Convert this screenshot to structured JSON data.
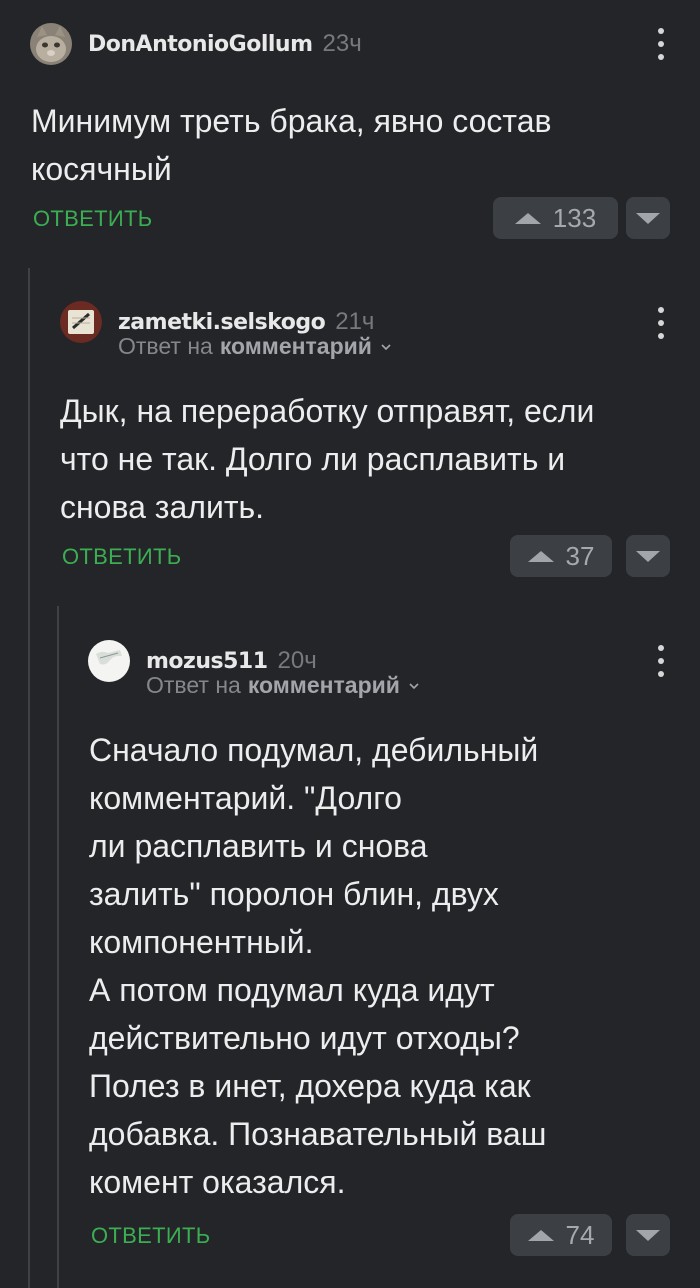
{
  "comments": [
    {
      "username": "DonAntonioGollum",
      "time": "23ч",
      "text": "Минимум треть брака, явно состав\nкосячный",
      "reply_label": "ОТВЕТИТЬ",
      "votes": "133",
      "avatar": "cat-avatar"
    },
    {
      "username": "zametki.selskogo",
      "time": "21ч",
      "reply_prefix": "Ответ на",
      "reply_target": "комментарий",
      "text": "Дык, на переработку отправят, если\nчто не так. Долго ли расплавить и\nснова залить.",
      "reply_label": "ОТВЕТИТЬ",
      "votes": "37",
      "avatar": "notebook-avatar"
    },
    {
      "username": "mozus511",
      "time": "20ч",
      "reply_prefix": "Ответ на",
      "reply_target": "комментарий",
      "text": "Сначало подумал, дебильный\nкомментарий. \"Долго\nли расплавить и снова\nзалить\" поролон блин, двух\nкомпонентный.\nА потом подумал куда идут\nдействительно идут отходы?\nПолез в инет, дохера куда как\nдобавка. Познавательный ваш\nкомент оказался.",
      "reply_label": "ОТВЕТИТЬ",
      "votes": "74",
      "avatar": "white-avatar"
    }
  ],
  "colors": {
    "background": "#232529",
    "accent_green": "#3cae52",
    "vote_button": "#3c3f44"
  }
}
